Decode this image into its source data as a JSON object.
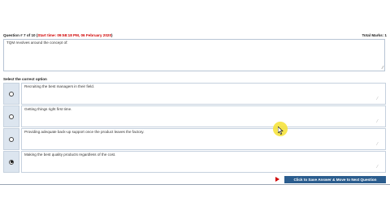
{
  "header": {
    "question_label": "Question # 7 of 10 (",
    "start_time": "Start time: 09:58:18 PM, 06 February 2020",
    "close_paren": ")",
    "total_marks": "Total Marks: 1"
  },
  "question": {
    "text": "TQM revolves around the concept of:"
  },
  "options_label": "Select the correct option",
  "options": [
    {
      "text": "Recruiting the best managers in their field.",
      "selected": false
    },
    {
      "text": "Getting things right first time.",
      "selected": false
    },
    {
      "text": "Providing adequate back-up support once the product leaves the factory.",
      "selected": false
    },
    {
      "text": "Making the best quality products regardless of the cost.",
      "selected": true
    }
  ],
  "footer": {
    "next_button_label": "Click to Save Answer & Move to Next Question"
  },
  "colors": {
    "accent": "#2b5d8e",
    "start_time": "#d00000",
    "cursor_highlight": "#f6e232"
  }
}
